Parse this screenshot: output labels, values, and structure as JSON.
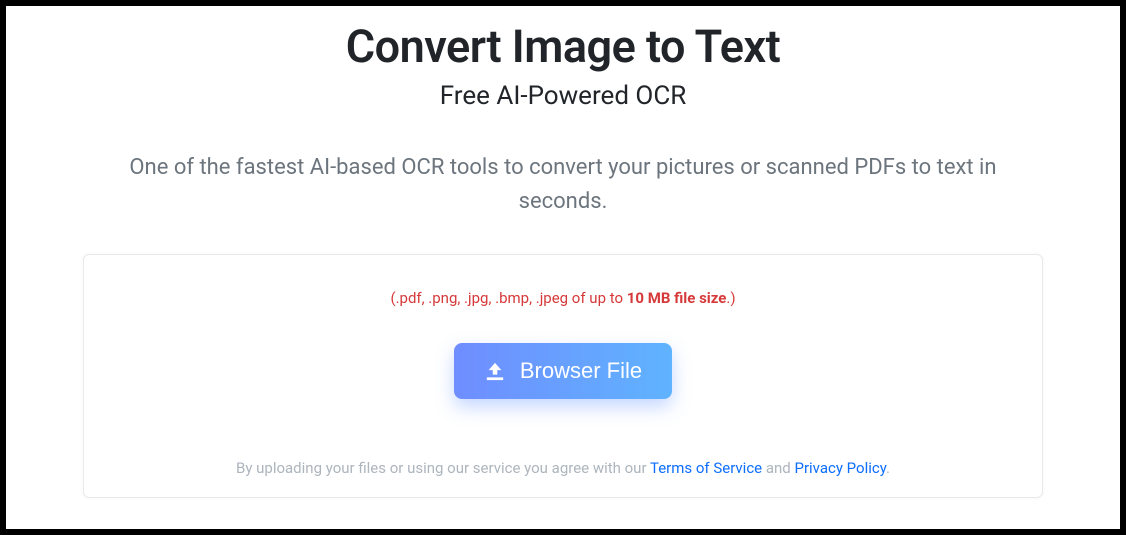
{
  "header": {
    "title": "Convert Image to Text",
    "subtitle": "Free AI-Powered OCR",
    "description": "One of the fastest AI-based OCR tools to convert your pictures or scanned PDFs to text in seconds."
  },
  "upload": {
    "note_prefix": "(.pdf, .png, .jpg, .bmp, .jpeg of up to ",
    "note_bold": "10 MB file size",
    "note_suffix": ".)",
    "button_label": "Browser File"
  },
  "agreement": {
    "prefix": "By uploading your files or using our service you agree with our ",
    "terms_label": "Terms of Service",
    "mid": " and ",
    "privacy_label": "Privacy Policy",
    "suffix": "."
  }
}
